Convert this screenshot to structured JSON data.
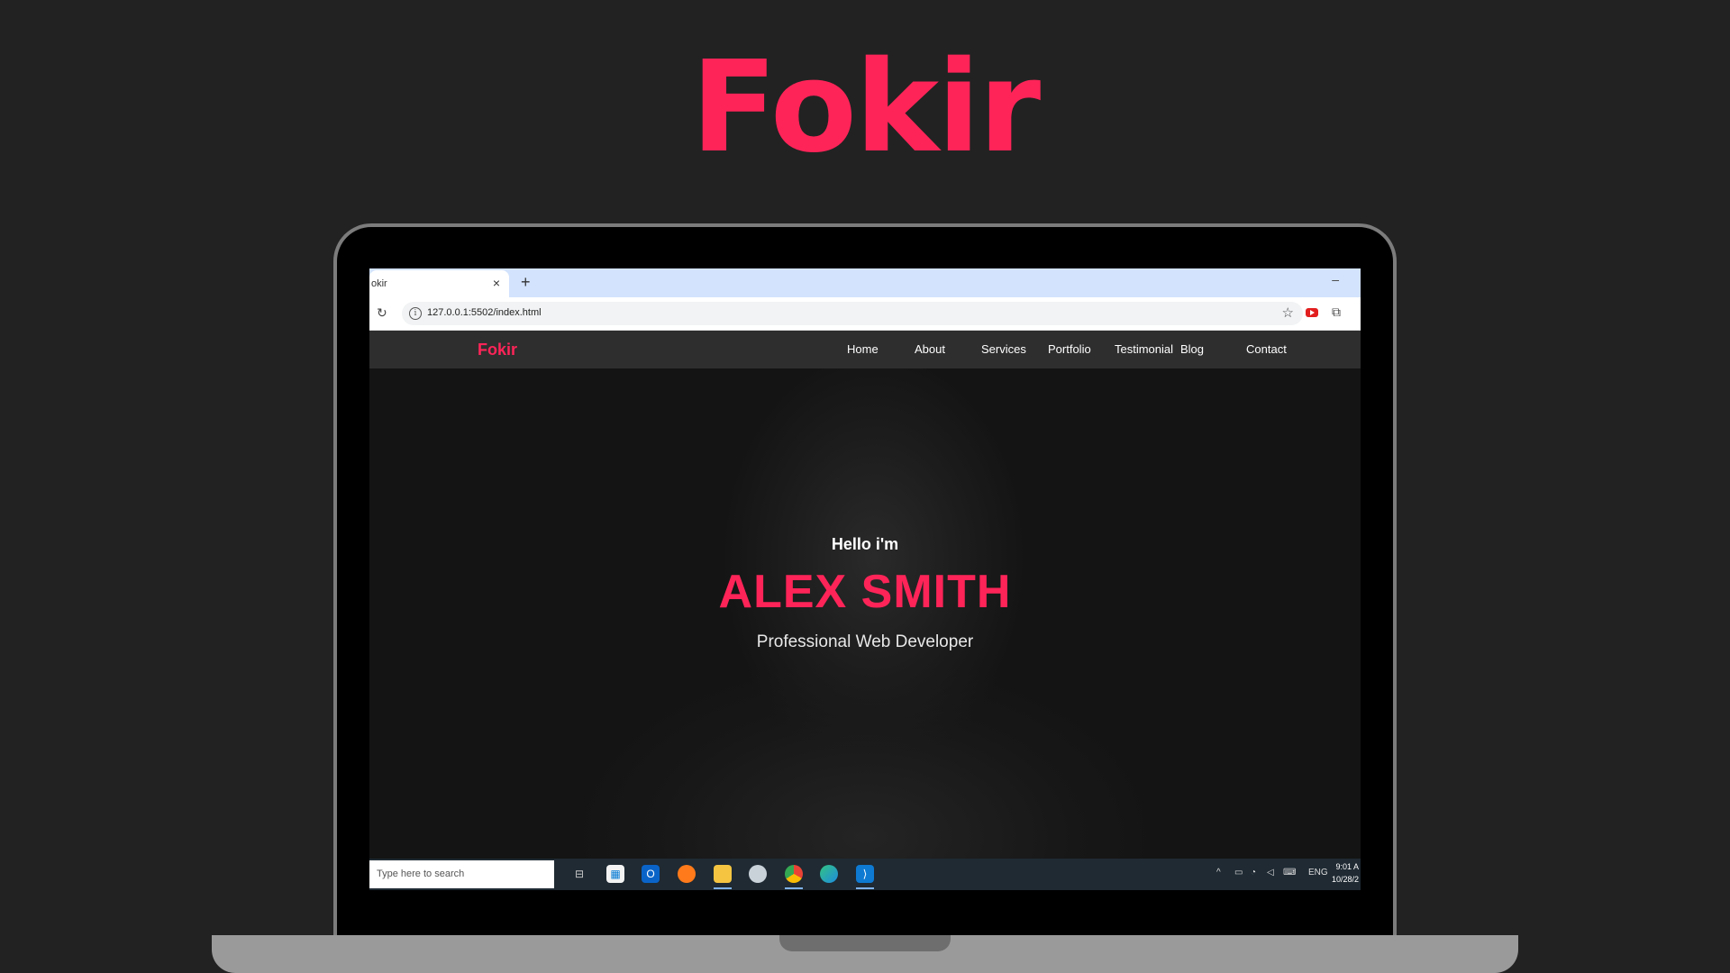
{
  "page_title": "Fokir",
  "browser": {
    "tab_title": "okir",
    "tab_close": "×",
    "new_tab": "+",
    "minimize": "–",
    "url": "127.0.0.1:5502/index.html"
  },
  "site": {
    "logo": "Fokir",
    "nav": [
      "Home",
      "About",
      "Services",
      "Portfolio",
      "Testimonial",
      "Blog",
      "Contact"
    ],
    "hero": {
      "greeting": "Hello i'm",
      "name": "ALEX SMITH",
      "role": "Professional Web Developer"
    }
  },
  "taskbar": {
    "search_placeholder": "Type here to search",
    "apps": [
      "task-view-icon",
      "store-icon",
      "outlook-icon",
      "firefox-icon",
      "file-explorer-icon",
      "app-icon",
      "chrome-icon",
      "edge-icon",
      "vscode-icon"
    ],
    "tray": {
      "language": "ENG",
      "time": "9:01 A",
      "date": "10/28/2"
    }
  },
  "colors": {
    "accent": "#ff2458",
    "background": "#222222"
  }
}
